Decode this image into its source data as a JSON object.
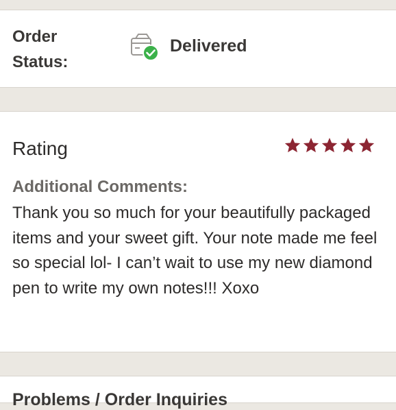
{
  "order_status": {
    "label": "Order Status:",
    "value": "Delivered",
    "icon": "package-delivered-icon",
    "check_color": "#3bb14a"
  },
  "rating": {
    "label": "Rating",
    "stars": 5,
    "max_stars": 5,
    "star_color": "#8c2532"
  },
  "comments": {
    "heading": "Additional Comments:",
    "text": "Thank you so much for your beautifully packaged items and your sweet gift. Your note made me feel so special lol- I can’t wait to use my new diamond pen to write my own notes!!! Xoxo"
  },
  "next_section": {
    "title": "Problems / Order Inquiries"
  }
}
